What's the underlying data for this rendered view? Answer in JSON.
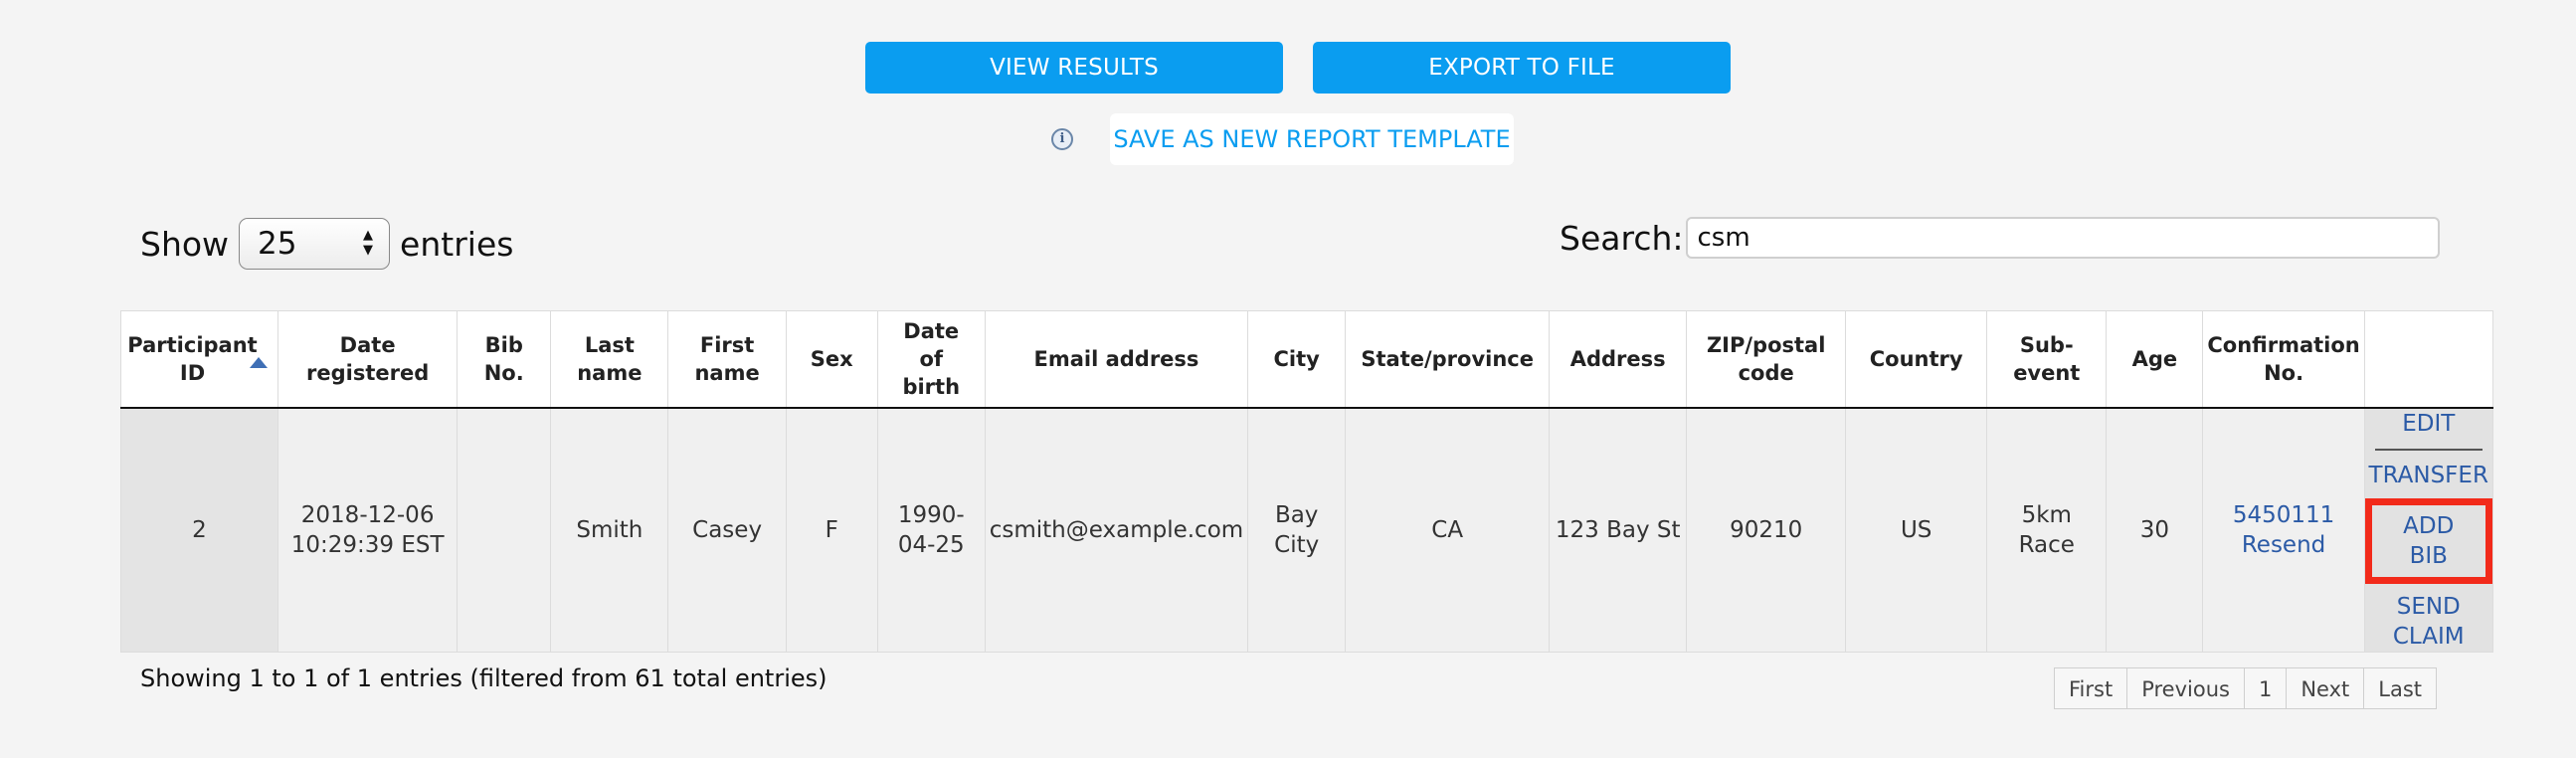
{
  "toolbar": {
    "view_results_label": "VIEW RESULTS",
    "export_label": "EXPORT TO FILE",
    "info_glyph": "i",
    "save_template_label": "SAVE AS NEW REPORT TEMPLATE"
  },
  "length_control": {
    "show_label": "Show",
    "selected_value": "25",
    "entries_label": "entries",
    "arrow_up": "▲",
    "arrow_down": "▼"
  },
  "search": {
    "label": "Search:",
    "value": "csm"
  },
  "table": {
    "columns": [
      "Participant ID",
      "Date registered",
      "Bib No.",
      "Last name",
      "First name",
      "Sex",
      "Date of birth",
      "Email address",
      "City",
      "State/province",
      "Address",
      "ZIP/postal code",
      "Country",
      "Sub-event",
      "Age",
      "Confirmation No.",
      ""
    ],
    "sorted_column": "Participant ID",
    "sort_direction": "ascending",
    "rows": [
      {
        "participant_id": "2",
        "date_registered": "2018-12-06 10:29:39 EST",
        "bib_no": "",
        "last_name": "Smith",
        "first_name": "Casey",
        "sex": "F",
        "date_of_birth": "1990-04-25",
        "email": "csmith@example.com",
        "city": "Bay City",
        "state": "CA",
        "address": "123 Bay St",
        "zip": "90210",
        "country": "US",
        "sub_event": "5km Race",
        "age": "30",
        "confirmation_no": "5450111",
        "resend_label": "Resend",
        "actions": {
          "edit": "EDIT",
          "transfer": "TRANSFER",
          "add_bib": "ADD BIB",
          "send_claim": "SEND CLAIM"
        }
      }
    ]
  },
  "footer": {
    "info_text": "Showing 1 to 1 of 1 entries (filtered from 61 total entries)",
    "pagination": {
      "first": "First",
      "previous": "Previous",
      "current_page": "1",
      "next": "Next",
      "last": "Last"
    }
  },
  "colors": {
    "primary_button": "#0a9df0",
    "link": "#2b5aa6",
    "highlight_border": "#f22a1a",
    "sort_arrow": "#3f6fb5"
  }
}
